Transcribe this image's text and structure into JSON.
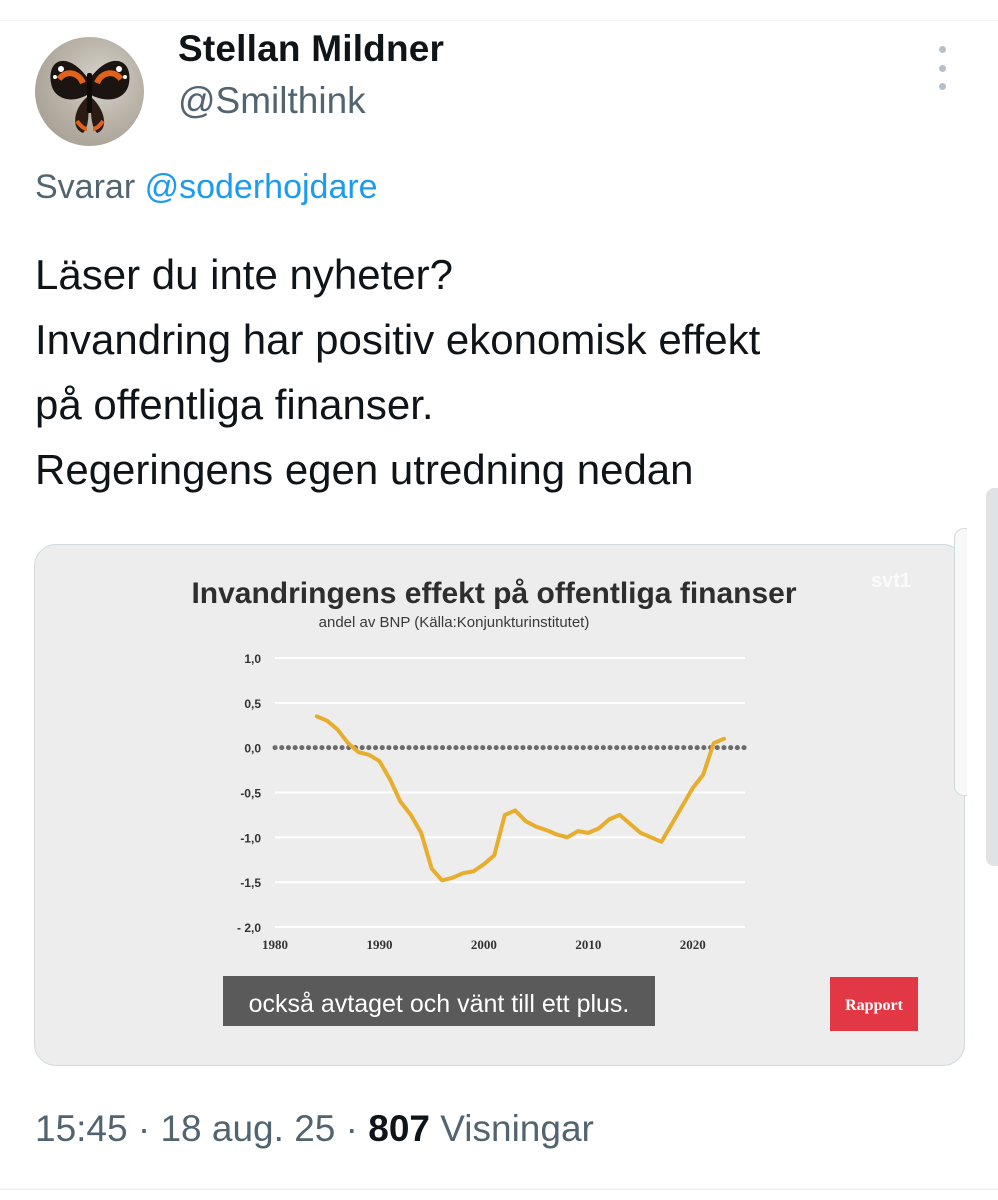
{
  "author": {
    "name": "Stellan Mildner",
    "handle": "@Smilthink"
  },
  "reply": {
    "prefix": "Svarar",
    "mention": "@soderhojdare"
  },
  "tweet": {
    "lines": [
      "Läser du inte nyheter?",
      "Invandring har positiv ekonomisk effekt",
      "på offentliga finanser.",
      "Regeringens egen utredning nedan"
    ]
  },
  "media": {
    "watermark": "svt1",
    "subtitle": "också avtaget och vänt till ett plus.",
    "program_badge": "Rapport",
    "badge_color": "#e23745",
    "line_color": "#e8ad2c"
  },
  "chart_data": {
    "type": "line",
    "title": "Invandringens effekt på offentliga finanser",
    "subtitle": "andel av BNP (Källa:Konjunkturinstitutet)",
    "xlabel": "",
    "ylabel": "",
    "x_ticks": [
      "1980",
      "1990",
      "2000",
      "2010",
      "2020"
    ],
    "y_ticks": [
      "1,0",
      "0,5",
      "0,0",
      "-0,5",
      "-1,0",
      "-1,5",
      "- 2,0"
    ],
    "xlim": [
      1980,
      2025
    ],
    "ylim": [
      -2.0,
      1.0
    ],
    "reference_line": 0.0,
    "grid": true,
    "series": [
      {
        "x": [
          1984,
          1985,
          1986,
          1987,
          1988,
          1989,
          1990,
          1991,
          1992,
          1993,
          1994,
          1995,
          1996,
          1997,
          1998,
          1999,
          2000,
          2001,
          2002,
          2003,
          2004,
          2005,
          2006,
          2007,
          2008,
          2009,
          2010,
          2011,
          2012,
          2013,
          2014,
          2015,
          2016,
          2017,
          2018,
          2019,
          2020,
          2021,
          2022,
          2023
        ],
        "y": [
          0.35,
          0.3,
          0.2,
          0.05,
          -0.05,
          -0.08,
          -0.15,
          -0.35,
          -0.6,
          -0.75,
          -0.95,
          -1.35,
          -1.48,
          -1.45,
          -1.4,
          -1.38,
          -1.3,
          -1.2,
          -0.75,
          -0.7,
          -0.82,
          -0.88,
          -0.92,
          -0.97,
          -1.0,
          -0.93,
          -0.95,
          -0.9,
          -0.8,
          -0.75,
          -0.85,
          -0.95,
          -1.0,
          -1.05,
          -0.85,
          -0.65,
          -0.45,
          -0.3,
          0.05,
          0.1
        ]
      }
    ]
  }
}
